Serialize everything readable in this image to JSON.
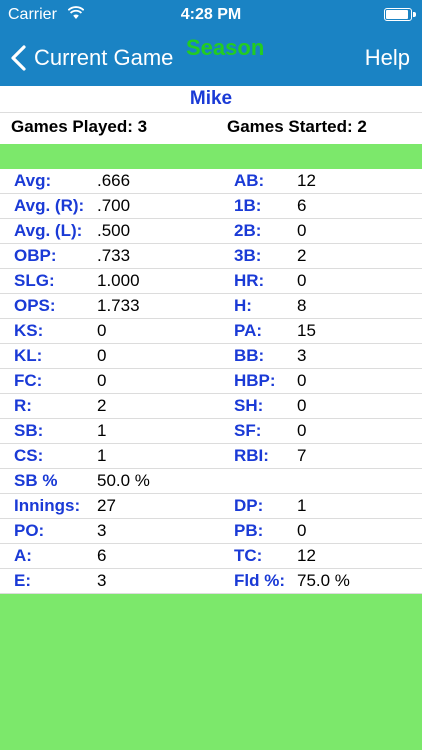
{
  "status_bar": {
    "carrier": "Carrier",
    "time": "4:28 PM"
  },
  "nav": {
    "back_label": "Current Game",
    "title": "Season",
    "help_label": "Help"
  },
  "player": {
    "name": "Mike",
    "games_played": "Games Played: 3",
    "games_started": "Games Started: 2"
  },
  "stats": [
    {
      "lk": "Avg:",
      "lv": ".666",
      "rk": "AB:",
      "rv": "12"
    },
    {
      "lk": "Avg. (R):",
      "lv": ".700",
      "rk": "1B:",
      "rv": "6"
    },
    {
      "lk": "Avg. (L):",
      "lv": ".500",
      "rk": "2B:",
      "rv": "0"
    },
    {
      "lk": "OBP:",
      "lv": ".733",
      "rk": "3B:",
      "rv": "2"
    },
    {
      "lk": "SLG:",
      "lv": "1.000",
      "rk": "HR:",
      "rv": "0"
    },
    {
      "lk": "OPS:",
      "lv": "1.733",
      "rk": "H:",
      "rv": "8"
    },
    {
      "lk": "KS:",
      "lv": "0",
      "rk": "PA:",
      "rv": "15"
    },
    {
      "lk": "KL:",
      "lv": "0",
      "rk": "BB:",
      "rv": "3"
    },
    {
      "lk": "FC:",
      "lv": "0",
      "rk": "HBP:",
      "rv": "0"
    },
    {
      "lk": "R:",
      "lv": "2",
      "rk": "SH:",
      "rv": "0"
    },
    {
      "lk": "SB:",
      "lv": "1",
      "rk": "SF:",
      "rv": "0"
    },
    {
      "lk": "CS:",
      "lv": "1",
      "rk": "RBI:",
      "rv": "7"
    },
    {
      "lk": "SB %",
      "lv": "50.0 %",
      "rk": "",
      "rv": ""
    },
    {
      "lk": "Innings:",
      "lv": "27",
      "rk": "DP:",
      "rv": "1"
    },
    {
      "lk": "PO:",
      "lv": "3",
      "rk": "PB:",
      "rv": "0"
    },
    {
      "lk": "A:",
      "lv": "6",
      "rk": "TC:",
      "rv": "12"
    },
    {
      "lk": "E:",
      "lv": "3",
      "rk": "Fld %:",
      "rv": "75.0 %"
    }
  ],
  "colors": {
    "nav_bg": "#1a83c4",
    "accent_green": "#7ce86b",
    "label_blue": "#1a3ad6",
    "season_green": "#22cc22"
  },
  "icons": {
    "back": "chevron-left-icon",
    "wifi": "wifi-icon",
    "battery": "battery-icon"
  }
}
